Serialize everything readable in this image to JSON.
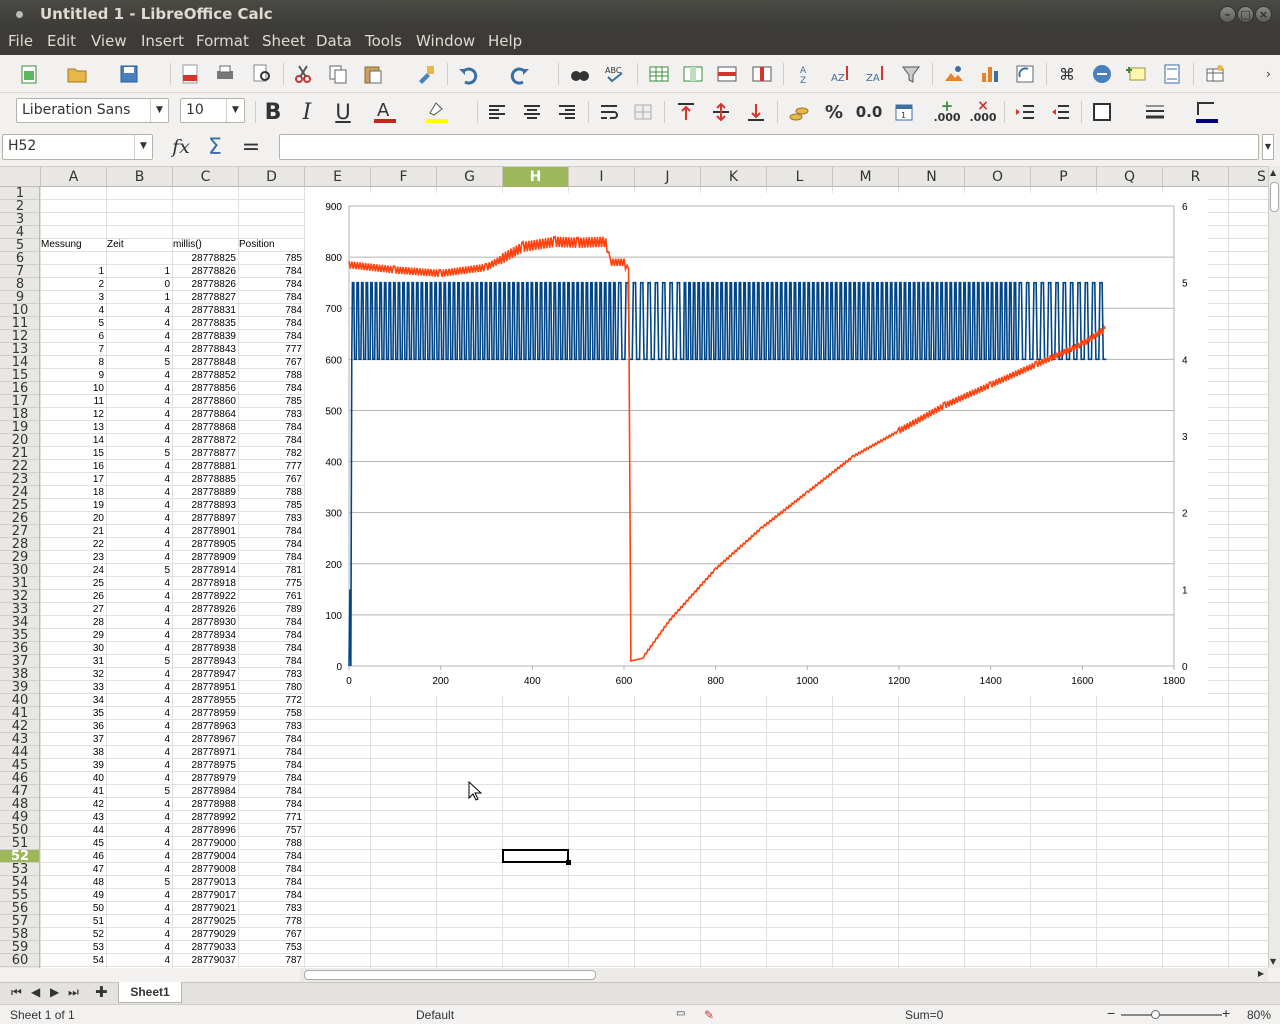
{
  "window": {
    "title": "Untitled 1 - LibreOffice Calc"
  },
  "menu": [
    "File",
    "Edit",
    "View",
    "Insert",
    "Format",
    "Sheet",
    "Data",
    "Tools",
    "Window",
    "Help"
  ],
  "format_bar": {
    "font_name": "Liberation Sans",
    "font_size": "10",
    "percent_label": "%",
    "decimal_label": "0.0",
    "add_decimal_label": ".000",
    "del_decimal_label": ".000"
  },
  "formula_bar": {
    "name_box": "H52",
    "formula_value": ""
  },
  "columns": [
    "A",
    "B",
    "C",
    "D",
    "E",
    "F",
    "G",
    "H",
    "I",
    "J",
    "K",
    "L",
    "M",
    "N",
    "O",
    "P",
    "Q",
    "R",
    "S"
  ],
  "selected_column": "H",
  "selected_row": "52",
  "headers": {
    "a": "Messung",
    "b": "Zeit",
    "c": "millis()",
    "d": "Position"
  },
  "rows": [
    [
      "",
      "",
      "28778825",
      "785"
    ],
    [
      "1",
      "1",
      "28778826",
      "784"
    ],
    [
      "2",
      "0",
      "28778826",
      "784"
    ],
    [
      "3",
      "1",
      "28778827",
      "784"
    ],
    [
      "4",
      "4",
      "28778831",
      "784"
    ],
    [
      "5",
      "4",
      "28778835",
      "784"
    ],
    [
      "6",
      "4",
      "28778839",
      "784"
    ],
    [
      "7",
      "4",
      "28778843",
      "777"
    ],
    [
      "8",
      "5",
      "28778848",
      "767"
    ],
    [
      "9",
      "4",
      "28778852",
      "788"
    ],
    [
      "10",
      "4",
      "28778856",
      "784"
    ],
    [
      "11",
      "4",
      "28778860",
      "785"
    ],
    [
      "12",
      "4",
      "28778864",
      "783"
    ],
    [
      "13",
      "4",
      "28778868",
      "784"
    ],
    [
      "14",
      "4",
      "28778872",
      "784"
    ],
    [
      "15",
      "5",
      "28778877",
      "782"
    ],
    [
      "16",
      "4",
      "28778881",
      "777"
    ],
    [
      "17",
      "4",
      "28778885",
      "767"
    ],
    [
      "18",
      "4",
      "28778889",
      "788"
    ],
    [
      "19",
      "4",
      "28778893",
      "785"
    ],
    [
      "20",
      "4",
      "28778897",
      "783"
    ],
    [
      "21",
      "4",
      "28778901",
      "784"
    ],
    [
      "22",
      "4",
      "28778905",
      "784"
    ],
    [
      "23",
      "4",
      "28778909",
      "784"
    ],
    [
      "24",
      "5",
      "28778914",
      "781"
    ],
    [
      "25",
      "4",
      "28778918",
      "775"
    ],
    [
      "26",
      "4",
      "28778922",
      "761"
    ],
    [
      "27",
      "4",
      "28778926",
      "789"
    ],
    [
      "28",
      "4",
      "28778930",
      "784"
    ],
    [
      "29",
      "4",
      "28778934",
      "784"
    ],
    [
      "30",
      "4",
      "28778938",
      "784"
    ],
    [
      "31",
      "5",
      "28778943",
      "784"
    ],
    [
      "32",
      "4",
      "28778947",
      "783"
    ],
    [
      "33",
      "4",
      "28778951",
      "780"
    ],
    [
      "34",
      "4",
      "28778955",
      "772"
    ],
    [
      "35",
      "4",
      "28778959",
      "758"
    ],
    [
      "36",
      "4",
      "28778963",
      "783"
    ],
    [
      "37",
      "4",
      "28778967",
      "784"
    ],
    [
      "38",
      "4",
      "28778971",
      "784"
    ],
    [
      "39",
      "4",
      "28778975",
      "784"
    ],
    [
      "40",
      "4",
      "28778979",
      "784"
    ],
    [
      "41",
      "5",
      "28778984",
      "784"
    ],
    [
      "42",
      "4",
      "28778988",
      "784"
    ],
    [
      "43",
      "4",
      "28778992",
      "771"
    ],
    [
      "44",
      "4",
      "28778996",
      "757"
    ],
    [
      "45",
      "4",
      "28779000",
      "788"
    ],
    [
      "46",
      "4",
      "28779004",
      "784"
    ],
    [
      "47",
      "4",
      "28779008",
      "784"
    ],
    [
      "48",
      "5",
      "28779013",
      "784"
    ],
    [
      "49",
      "4",
      "28779017",
      "784"
    ],
    [
      "50",
      "4",
      "28779021",
      "783"
    ],
    [
      "51",
      "4",
      "28779025",
      "778"
    ],
    [
      "52",
      "4",
      "28779029",
      "767"
    ],
    [
      "53",
      "4",
      "28779033",
      "753"
    ],
    [
      "54",
      "4",
      "28779037",
      "787"
    ]
  ],
  "chart_data": {
    "type": "line",
    "title": "",
    "xlabel": "",
    "ylabel": "",
    "xlim": [
      0,
      1800
    ],
    "ylim": [
      0,
      900
    ],
    "y2lim": [
      0,
      6
    ],
    "x_ticks": [
      "0",
      "200",
      "400",
      "600",
      "800",
      "1000",
      "1200",
      "1400",
      "1600",
      "1800"
    ],
    "y_ticks": [
      "0",
      "100",
      "200",
      "300",
      "400",
      "500",
      "600",
      "700",
      "800",
      "900"
    ],
    "y2_ticks": [
      "0",
      "1",
      "2",
      "3",
      "4",
      "5",
      "6"
    ],
    "grid": true,
    "legend": "none",
    "series": [
      {
        "axis": "secondary",
        "color": "#004586",
        "style": "oscillating between 4 and 5",
        "x_range": [
          0,
          1650
        ],
        "low": 4,
        "high": 5
      },
      {
        "axis": "primary",
        "color": "#ff420e",
        "points": [
          [
            0,
            785
          ],
          [
            100,
            775
          ],
          [
            200,
            768
          ],
          [
            300,
            780
          ],
          [
            380,
            820
          ],
          [
            450,
            830
          ],
          [
            500,
            828
          ],
          [
            560,
            830
          ],
          [
            570,
            790
          ],
          [
            600,
            790
          ],
          [
            610,
            770
          ],
          [
            615,
            10
          ],
          [
            640,
            15
          ],
          [
            700,
            90
          ],
          [
            800,
            190
          ],
          [
            900,
            270
          ],
          [
            1000,
            340
          ],
          [
            1100,
            410
          ],
          [
            1200,
            460
          ],
          [
            1300,
            510
          ],
          [
            1400,
            550
          ],
          [
            1500,
            590
          ],
          [
            1600,
            630
          ],
          [
            1650,
            660
          ]
        ]
      }
    ]
  },
  "sheet_tab": "Sheet1",
  "status": {
    "sheet": "Sheet 1 of 1",
    "style": "Default",
    "sum": "Sum=0",
    "zoom": "80%"
  }
}
